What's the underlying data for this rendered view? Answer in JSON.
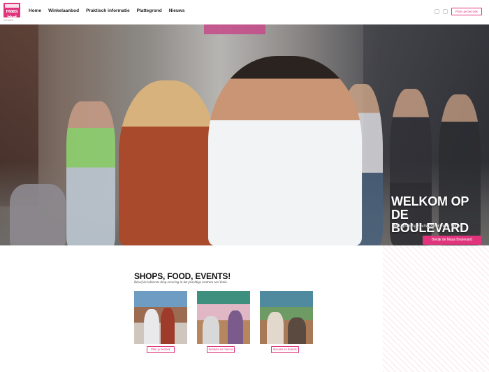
{
  "brand": {
    "logo_word": "maas blvd",
    "logo_sub": "VENLO",
    "accent": "#e0357d"
  },
  "nav": {
    "items": [
      {
        "label": "Home"
      },
      {
        "label": "Winkelaanbod"
      },
      {
        "label": "Praktisch informatie"
      },
      {
        "label": "Plattegrond"
      },
      {
        "label": "Nieuws"
      }
    ],
    "social_icons": [
      "instagram-icon",
      "facebook-icon"
    ],
    "cta_label": "Plan uw bezoek"
  },
  "hero": {
    "title_line1": "WELKOM OP",
    "title_line2": "DE BOULEVARD",
    "subtitle": "Het gezellige winkelhart van Venlo",
    "button_label": "Bekijk de Maas Boulevard"
  },
  "section": {
    "title": "SHOPS, FOOD, EVENTS!",
    "subtitle": "Beleef de lekkerste shop-ervaring in het prachtige centrum van Venlo",
    "cards": [
      {
        "button_label": "Plan je bezoek"
      },
      {
        "button_label": "Winkels en horeca"
      },
      {
        "button_label": "Nieuws en Events"
      }
    ]
  }
}
